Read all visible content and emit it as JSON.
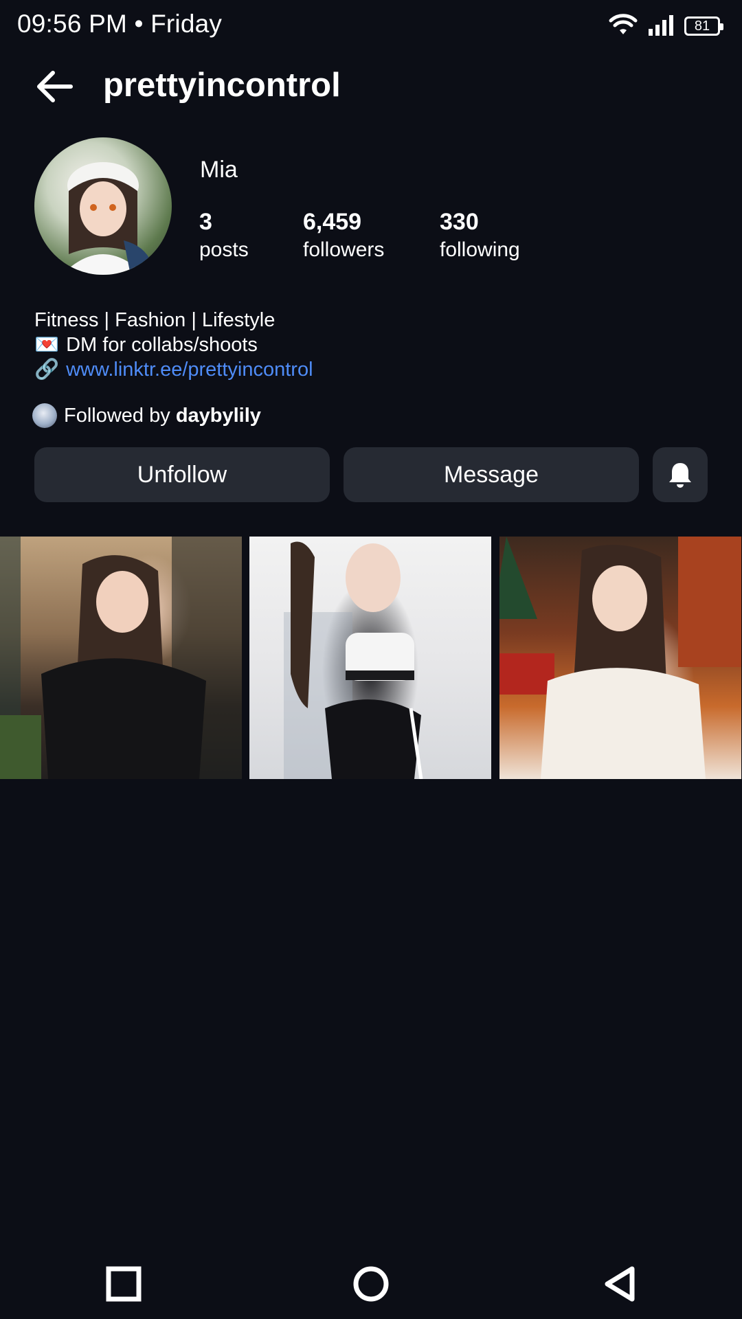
{
  "status_bar": {
    "time": "09:56 PM • Friday",
    "battery": "81",
    "icons": [
      "wifi-icon",
      "signal-icon",
      "battery-icon"
    ]
  },
  "header": {
    "username": "prettyincontrol",
    "back_icon": "arrow-left-icon"
  },
  "profile": {
    "display_name": "Mia",
    "stats": [
      {
        "value": "3",
        "label": "posts"
      },
      {
        "value": "6,459",
        "label": "followers"
      },
      {
        "value": "330",
        "label": "following"
      }
    ],
    "bio": {
      "line1": "Fitness | Fashion | Lifestyle",
      "line2_emoji": "💌",
      "line2": "DM for collabs/shoots",
      "line3_emoji": "🔗",
      "link": "www.linktr.ee/prettyincontrol"
    },
    "followed_by_prefix": "Followed by ",
    "followed_by_user": "daybylily"
  },
  "actions": {
    "unfollow": "Unfollow",
    "message": "Message",
    "bell_icon": "bell-icon"
  },
  "posts": [
    {
      "name": "post-1"
    },
    {
      "name": "post-2"
    },
    {
      "name": "post-3"
    }
  ],
  "nav": {
    "icons": [
      "recents-square-icon",
      "home-circle-icon",
      "back-triangle-icon"
    ]
  },
  "colors": {
    "background": "#0c0e16",
    "button": "#262a33",
    "link": "#4f8cf7"
  }
}
